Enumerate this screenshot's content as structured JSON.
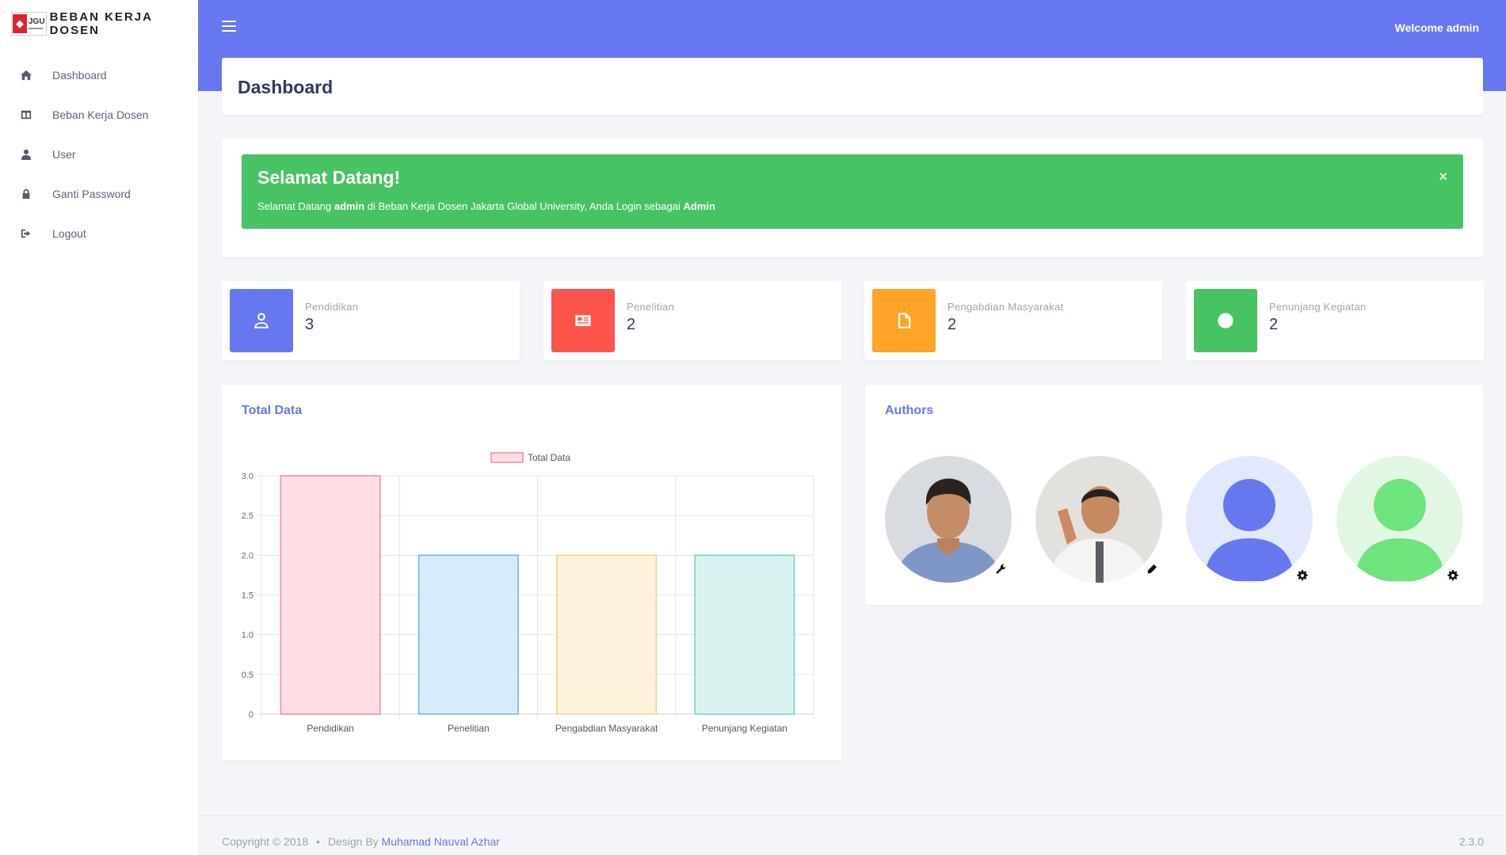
{
  "brand": {
    "logo_text": "JGU",
    "name": "BEBAN KERJA DOSEN"
  },
  "sidebar": {
    "items": [
      {
        "label": "Dashboard",
        "icon": "home-icon"
      },
      {
        "label": "Beban Kerja Dosen",
        "icon": "table-icon"
      },
      {
        "label": "User",
        "icon": "user-icon"
      },
      {
        "label": "Ganti Password",
        "icon": "lock-icon"
      },
      {
        "label": "Logout",
        "icon": "sign-out-icon"
      }
    ]
  },
  "topbar": {
    "welcome": "Welcome admin"
  },
  "page": {
    "title": "Dashboard"
  },
  "alert": {
    "title": "Selamat Datang!",
    "text_prefix": "Selamat Datang ",
    "user": "admin",
    "text_middle": " di Beban Kerja Dosen Jakarta Global University, Anda Login sebagai ",
    "role": "Admin",
    "close": "×",
    "color": "#47c363"
  },
  "stats": [
    {
      "label": "Pendidikan",
      "value": "3",
      "color": "#6777ef",
      "icon": "user-outline-icon"
    },
    {
      "label": "Penelitian",
      "value": "2",
      "color": "#fc544b",
      "icon": "newspaper-icon"
    },
    {
      "label": "Pengabdian Masyarakat",
      "value": "2",
      "color": "#ffa426",
      "icon": "file-icon"
    },
    {
      "label": "Penunjang Kegiatan",
      "value": "2",
      "color": "#47c363",
      "icon": "circle-icon"
    }
  ],
  "chart_card": {
    "title": "Total Data"
  },
  "chart_data": {
    "type": "bar",
    "categories": [
      "Pendidikan",
      "Penelitian",
      "Pengabdian Masyarakat",
      "Penunjang Kegiatan"
    ],
    "series": [
      {
        "name": "Total Data",
        "values": [
          3,
          2,
          2,
          2
        ]
      }
    ],
    "ylim": [
      0,
      3
    ],
    "yticks": [
      "0",
      "0.5",
      "1.0",
      "1.5",
      "2.0",
      "2.5",
      "3.0"
    ],
    "fill_colors": [
      "#ffdde4",
      "#d8ebfa",
      "#fff2dc",
      "#daf2ef"
    ],
    "border_colors": [
      "#ef8aa3",
      "#6eb3e6",
      "#f5cf7d",
      "#75cfc6"
    ],
    "legend": "top-center",
    "grid": true
  },
  "authors": {
    "title": "Authors",
    "items": [
      {
        "name": "author-1",
        "badge": "wrench-icon"
      },
      {
        "name": "author-2",
        "badge": "pencil-icon"
      },
      {
        "name": "author-3",
        "badge": "gear-icon"
      },
      {
        "name": "author-4",
        "badge": "gear-icon"
      }
    ]
  },
  "footer": {
    "copyright": "Copyright © 2018",
    "design_by": "Design By ",
    "author": "Muhamad Nauval Azhar",
    "version": "2.3.0"
  }
}
